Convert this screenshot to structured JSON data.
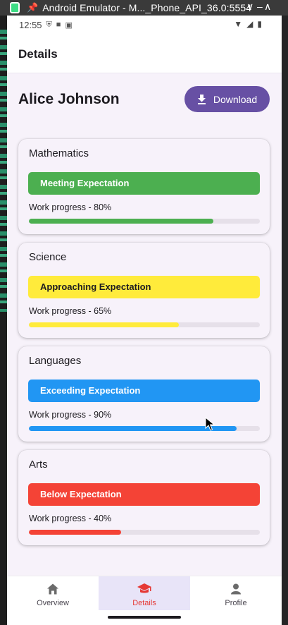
{
  "window": {
    "title": "Android Emulator - M..._Phone_API_36.0:5554",
    "controls": [
      "v",
      "–",
      "^"
    ]
  },
  "statusbar": {
    "time": "12:55"
  },
  "appbar": {
    "title": "Details"
  },
  "student": {
    "name": "Alice Johnson"
  },
  "download": {
    "label": "Download",
    "icon": "download-icon",
    "color": "#6750a4"
  },
  "subjects": [
    {
      "name": "Mathematics",
      "status": "Meeting Expectation",
      "progress_label": "Work progress - 80%",
      "progress": 0.8,
      "color": "#4caf50",
      "text_color": "#ffffff"
    },
    {
      "name": "Science",
      "status": "Approaching Expectation",
      "progress_label": "Work progress - 65%",
      "progress": 0.65,
      "color": "#ffeb3b",
      "text_color": "#1d1b20"
    },
    {
      "name": "Languages",
      "status": "Exceeding Expectation",
      "progress_label": "Work progress - 90%",
      "progress": 0.9,
      "color": "#2196f3",
      "text_color": "#ffffff"
    },
    {
      "name": "Arts",
      "status": "Below Expectation",
      "progress_label": "Work progress - 40%",
      "progress": 0.4,
      "color": "#f44336",
      "text_color": "#ffffff"
    }
  ],
  "nav": {
    "items": [
      {
        "label": "Overview",
        "icon": "home-icon",
        "active": false
      },
      {
        "label": "Details",
        "icon": "school-icon",
        "active": true
      },
      {
        "label": "Profile",
        "icon": "person-icon",
        "active": false
      }
    ],
    "active_color": "#e53935"
  }
}
